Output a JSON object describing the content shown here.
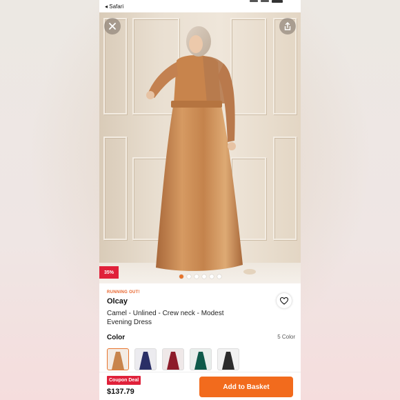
{
  "statusbar": {
    "back_label": "◂ Safari"
  },
  "product_image": {
    "description_icon": "dress-photo",
    "discount_badge": "35%",
    "carousel_dots": 6,
    "active_dot": 0,
    "close_icon": "close-icon",
    "share_icon": "share-icon"
  },
  "details": {
    "stock_notice": "RUNNING OUT!",
    "brand": "Olcay",
    "title": "Camel - Unlined - Crew neck - Modest Evening Dress",
    "color_label": "Color",
    "color_count": "5 Color",
    "swatches": [
      {
        "name": "camel",
        "color": "#c8844c"
      },
      {
        "name": "navy",
        "color": "#2a2f66"
      },
      {
        "name": "burgundy",
        "color": "#8d1c2a"
      },
      {
        "name": "emerald",
        "color": "#0e5a4a"
      },
      {
        "name": "black",
        "color": "#2b2b2b"
      }
    ]
  },
  "bottombar": {
    "coupon_label": "Coupon Deal",
    "price": "$137.79",
    "add_to_basket": "Add to Basket"
  },
  "colors": {
    "accent": "#f26b1d",
    "badge_red": "#e0213a",
    "notice": "#e8642c"
  }
}
